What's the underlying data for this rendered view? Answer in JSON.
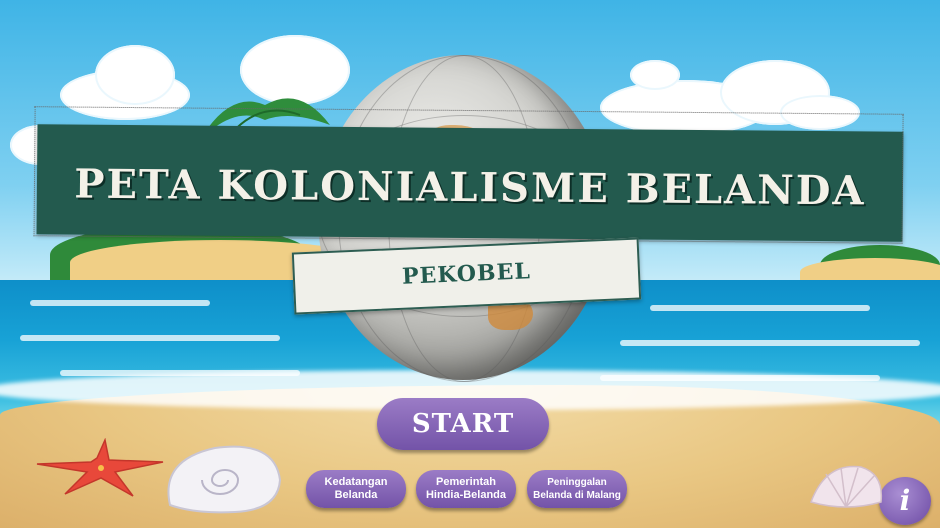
{
  "title": "PETA KOLONIALISME BELANDA",
  "subtitle": "PEKOBEL",
  "buttons": {
    "start": "START",
    "kedatangan": "Kedatangan Belanda",
    "pemerintah": "Pemerintah Hindia-Belanda",
    "peninggalan": "Peninggalan Belanda di Malang",
    "info": "i"
  },
  "icons": {
    "globe": "globe-icon",
    "starfish": "starfish-icon",
    "seashell": "seashell-icon",
    "scallop": "scallop-shell-icon",
    "info": "info-icon"
  },
  "colors": {
    "banner": "#235a4e",
    "button": "#7f5fb3",
    "sky": "#3fb4e6",
    "sea": "#18a2d6",
    "sand": "#e9c783"
  }
}
